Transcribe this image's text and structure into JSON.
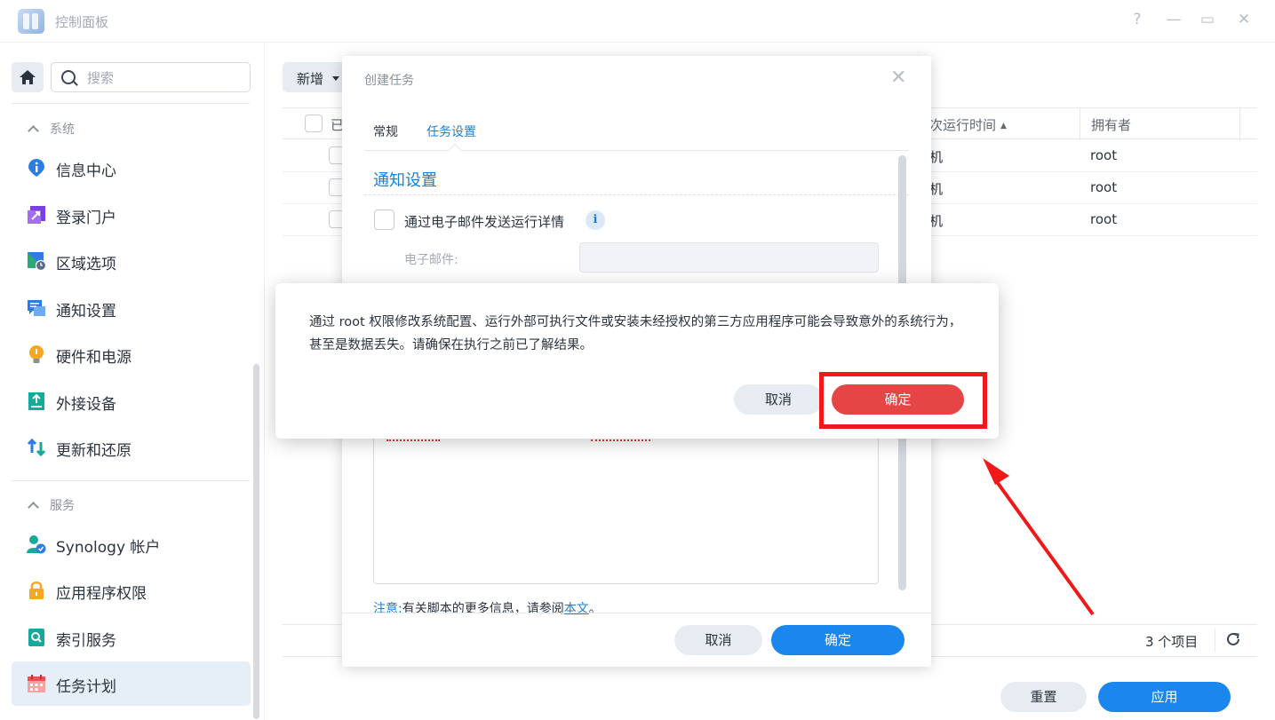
{
  "window": {
    "title": "控制面板",
    "controls": [
      "?",
      "—",
      "▭",
      "✕"
    ]
  },
  "sidebar": {
    "search_placeholder": "搜索",
    "sections": [
      {
        "label": "系统"
      },
      {
        "label": "服务"
      }
    ],
    "items": [
      {
        "label": "信息中心",
        "icon": "info-icon"
      },
      {
        "label": "登录门户",
        "icon": "login-portal-icon"
      },
      {
        "label": "区域选项",
        "icon": "regional-options-icon"
      },
      {
        "label": "通知设置",
        "icon": "notification-icon"
      },
      {
        "label": "硬件和电源",
        "icon": "hardware-power-icon"
      },
      {
        "label": "外接设备",
        "icon": "external-devices-icon"
      },
      {
        "label": "更新和还原",
        "icon": "update-restore-icon"
      },
      {
        "label": "Synology 帐户",
        "icon": "synology-account-icon"
      },
      {
        "label": "应用程序权限",
        "icon": "app-privileges-icon"
      },
      {
        "label": "索引服务",
        "icon": "indexing-service-icon"
      },
      {
        "label": "任务计划",
        "icon": "task-scheduler-icon",
        "active": true
      }
    ]
  },
  "main": {
    "add_button": "新增",
    "columns": {
      "enabled_partial": "已",
      "next_run_partial": "次运行时间",
      "owner": "拥有者"
    },
    "rows": [
      {
        "next_run_partial": "机",
        "owner": "root"
      },
      {
        "next_run_partial": "机",
        "owner": "root"
      },
      {
        "next_run_partial": "机",
        "owner": "root"
      }
    ],
    "item_count": "3 个项目",
    "reset_button": "重置",
    "apply_button": "应用"
  },
  "task_dialog": {
    "title": "创建任务",
    "tabs": [
      {
        "label": "常规",
        "active": false
      },
      {
        "label": "任务设置",
        "active": true
      }
    ],
    "section_title": "通知设置",
    "email_checkbox_label": "通过电子邮件发送运行详情",
    "email_label": "电子邮件:",
    "email_value": "",
    "note_prefix": "注意:",
    "note_text": "有关脚本的更多信息，请参阅",
    "note_link": "本文",
    "note_suffix": "。",
    "cancel_button": "取消",
    "ok_button": "确定"
  },
  "warning_dialog": {
    "message": "通过 root 权限修改系统配置、运行外部可执行文件或安装未经授权的第三方应用程序可能会导致意外的系统行为，甚至是数据丢失。请确保在执行之前已了解结果。",
    "cancel_button": "取消",
    "ok_button": "确定"
  },
  "colors": {
    "accent_blue": "#1a86ee",
    "danger_red": "#e64545",
    "highlight_red": "#f01818"
  }
}
